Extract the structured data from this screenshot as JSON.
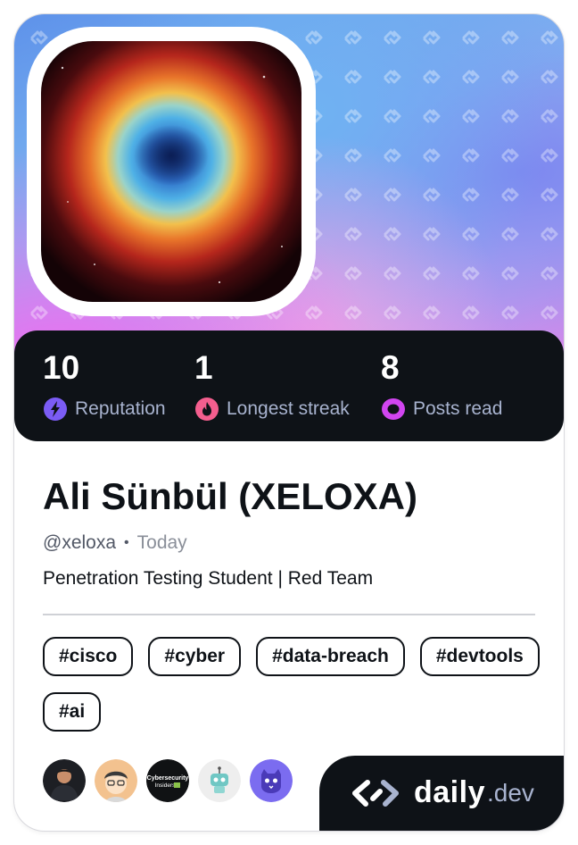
{
  "profile": {
    "name": "Ali Sünbül (XELOXA)",
    "handle": "@xeloxa",
    "separator": "•",
    "joined": "Today",
    "bio": "Penetration Testing Student | Red Team"
  },
  "stats": [
    {
      "value": "10",
      "label": "Reputation",
      "icon": "lightning-icon",
      "color": "#7b5cf5"
    },
    {
      "value": "1",
      "label": "Longest streak",
      "icon": "flame-icon",
      "color": "#f45e8e"
    },
    {
      "value": "8",
      "label": "Posts read",
      "icon": "eye-ring-icon",
      "color": "#d145f0"
    }
  ],
  "tags": [
    "#cisco",
    "#cyber",
    "#data-breach",
    "#devtools",
    "#ai"
  ],
  "squads": [
    {
      "name": "squad-avatar-1",
      "icon": "person-photo"
    },
    {
      "name": "squad-avatar-2",
      "icon": "cartoon-face"
    },
    {
      "name": "squad-avatar-3",
      "label": "Cybersecurity Insiders"
    },
    {
      "name": "squad-avatar-4",
      "icon": "robot-icon"
    },
    {
      "name": "squad-avatar-5",
      "icon": "cat-icon"
    }
  ],
  "brand": {
    "daily": "daily",
    "dev": ".dev"
  },
  "colors": {
    "dark": "#0e1217",
    "label": "#a8b3cf",
    "reputation": "#7b5cf5",
    "streak": "#f45e8e",
    "posts": "#d145f0"
  }
}
